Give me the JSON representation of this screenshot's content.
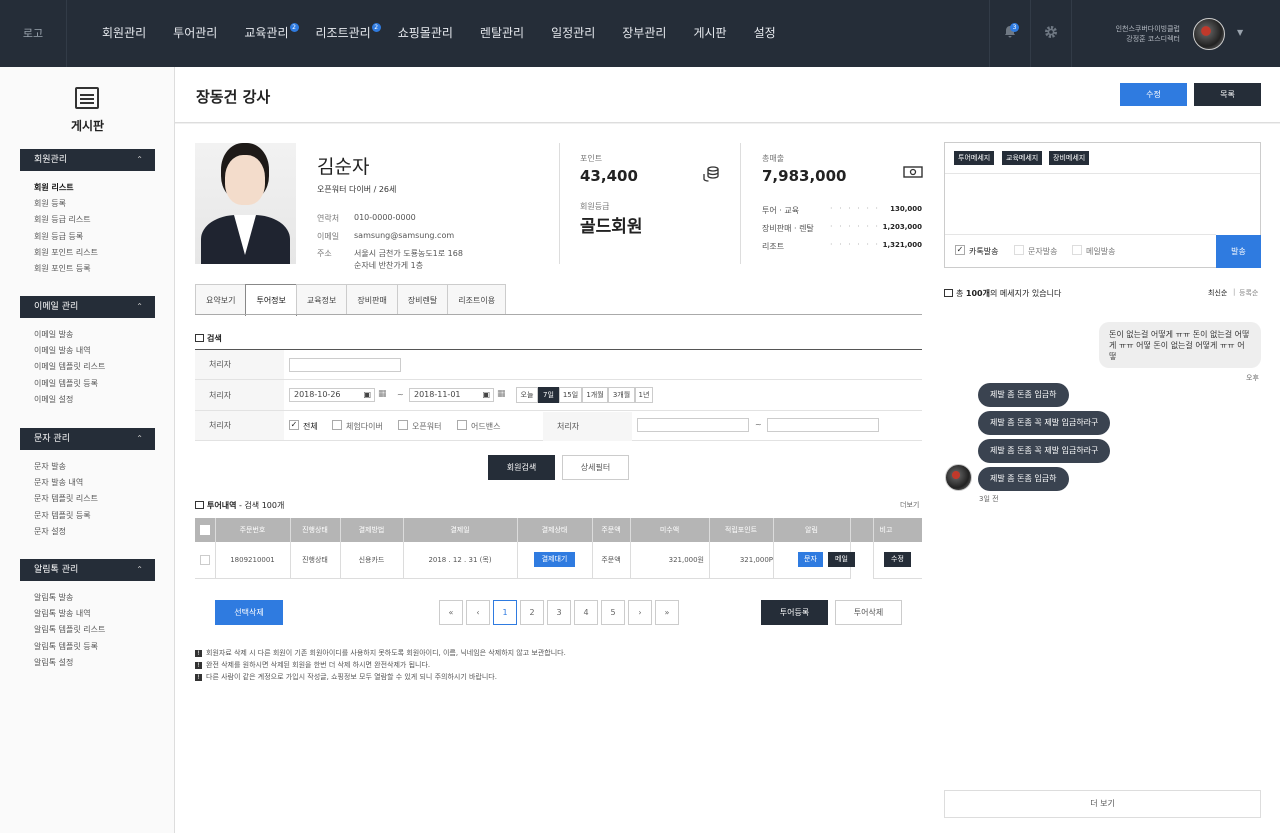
{
  "topbar": {
    "logo": "로고",
    "nav": [
      {
        "label": "회원관리",
        "badge": ""
      },
      {
        "label": "투어관리",
        "badge": ""
      },
      {
        "label": "교육관리",
        "badge": "2"
      },
      {
        "label": "리조트관리",
        "badge": "2"
      },
      {
        "label": "쇼핑몰관리",
        "badge": ""
      },
      {
        "label": "렌탈관리",
        "badge": ""
      },
      {
        "label": "일정관리",
        "badge": ""
      },
      {
        "label": "장부관리",
        "badge": ""
      },
      {
        "label": "게시판",
        "badge": ""
      },
      {
        "label": "설정",
        "badge": ""
      }
    ],
    "notification_count": "3",
    "user_org": "인천스쿠버다이빙클럽",
    "user_name": "강정훈 코스디렉터"
  },
  "sidebar": {
    "title": "게시판",
    "groups": [
      {
        "label": "회원관리",
        "items": [
          "회원 리스트",
          "회원 등록",
          "회원 등급 리스트",
          "회원 등급 등록",
          "회원 포인트 리스트",
          "회원 포인트 등록"
        ]
      },
      {
        "label": "이메일 관리",
        "items": [
          "이메일 발송",
          "이메일 발송 내역",
          "이메일 템플릿 리스트",
          "이메일 템플릿 등록",
          "이메일 설정"
        ]
      },
      {
        "label": "문자 관리",
        "items": [
          "문자 발송",
          "문자 발송 내역",
          "문자 템플릿 리스트",
          "문자 템플릿 등록",
          "문자 설정"
        ]
      },
      {
        "label": "알림톡 관리",
        "items": [
          "알림톡 발송",
          "알림톡 발송 내역",
          "알림톡 템플릿 리스트",
          "알림톡 템플릿 등록",
          "알림톡 설정"
        ]
      }
    ]
  },
  "header": {
    "title": "장동건 강사",
    "edit_label": "수정",
    "list_label": "목록"
  },
  "profile": {
    "name": "김순자",
    "subtitle": "오픈워터 다이버 / 26세",
    "phone_label": "연락처",
    "phone": "010-0000-0000",
    "email_label": "이메일",
    "email": "samsung@samsung.com",
    "address_label": "주소",
    "address1": "서울시 금천가 도룡농도1로 168",
    "address2": "순자네 반찬가게 1층",
    "point_label": "포인트",
    "point": "43,400",
    "grade_label": "회원등급",
    "grade": "골드회원",
    "sales_label": "총매출",
    "sales": "7,983,000",
    "breakdown": [
      {
        "label": "투어 · 교육",
        "value": "130,000"
      },
      {
        "label": "장비판매 · 렌탈",
        "value": "1,203,000"
      },
      {
        "label": "리조트",
        "value": "1,321,000"
      }
    ]
  },
  "tabs": [
    "요약보기",
    "투어정보",
    "교육정보",
    "장비판매",
    "장비렌탈",
    "리조트이용"
  ],
  "search": {
    "section_title": "검색",
    "label1": "처리자",
    "label2": "처리자",
    "date_from": "2018-10-26",
    "date_to": "2018-11-01",
    "tilde": "~",
    "periods": [
      "오늘",
      "7일",
      "15일",
      "1개월",
      "3개월",
      "1년"
    ],
    "label3": "처리자",
    "checks": [
      {
        "label": "전체",
        "checked": true
      },
      {
        "label": "체험다이버",
        "checked": false
      },
      {
        "label": "오픈워터",
        "checked": false
      },
      {
        "label": "어드밴스",
        "checked": false
      }
    ],
    "label4": "처리자",
    "search_button": "회원검색",
    "detail_button": "상세필터"
  },
  "tour": {
    "title_prefix": "투어내역",
    "title_suffix": "- 검색 100개",
    "more": "더보기",
    "columns": [
      "주문번호",
      "진행상태",
      "결제방법",
      "결제일",
      "결제상태",
      "주문액",
      "미수액",
      "적립포인트",
      "알림",
      "비고"
    ],
    "row": {
      "order_no": "1809210001",
      "progress": "진행상태",
      "method": "신용카드",
      "date": "2018 . 12 . 31 (목)",
      "pay_status": "결제대기",
      "amount": "주문액",
      "unpaid": "321,000원",
      "points": "321,000P",
      "sms": "문자",
      "mail": "메일",
      "edit": "수정"
    },
    "select_delete": "선택삭제",
    "pages": [
      "«",
      "‹",
      "1",
      "2",
      "3",
      "4",
      "5",
      "›",
      "»"
    ],
    "register": "투어등록",
    "delete": "투어삭제"
  },
  "notes": [
    "회원자료 삭제 시 다른 회원이 기존 회원아이디를 사용하지 못하도록 회원아이디, 이름, 닉네임은 삭제하지 않고 보관합니다.",
    "완전 삭제를 원하시면 삭제된 회원을 한번 더 삭제 하시면 완전삭제가 됩니다.",
    "다른 사람이 같은 계정으로 가입시 작성글, 쇼핑정보 모두 열람할 수 있게 되니 주의하시기 바랍니다."
  ],
  "messenger": {
    "tags": [
      "투어메세지",
      "교육메세지",
      "장비메세지"
    ],
    "options": [
      {
        "label": "카톡발송",
        "checked": true
      },
      {
        "label": "문자발송",
        "checked": false
      },
      {
        "label": "메일발송",
        "checked": false
      }
    ],
    "send": "발송",
    "count_prefix": "총",
    "count": "100개",
    "count_suffix": "의 메세지가 있습니다",
    "sort_latest": "최신순",
    "sort_registered": "등록순",
    "incoming": "돈이 없는걸 어떻게 ㅠㅠ 돈이 없는걸 어떻게 ㅠㅠ 어떻 돈이 없는걸 어떻게 ㅠㅠ 어떻",
    "incoming_time": "오후",
    "outgoing": [
      "제발 좀 돈좀 입금하",
      "제발 좀 돈좀 꼭 제발 입금하라구",
      "제발 좀 돈좀 꼭 제발 입금하라구",
      "제발 좀 돈좀 입금하"
    ],
    "outgoing_time": "3일 전",
    "more": "더 보기"
  },
  "colors": {
    "accent": "#2f7be0",
    "dark": "#252d38",
    "table_header": "#b5b5b5"
  }
}
